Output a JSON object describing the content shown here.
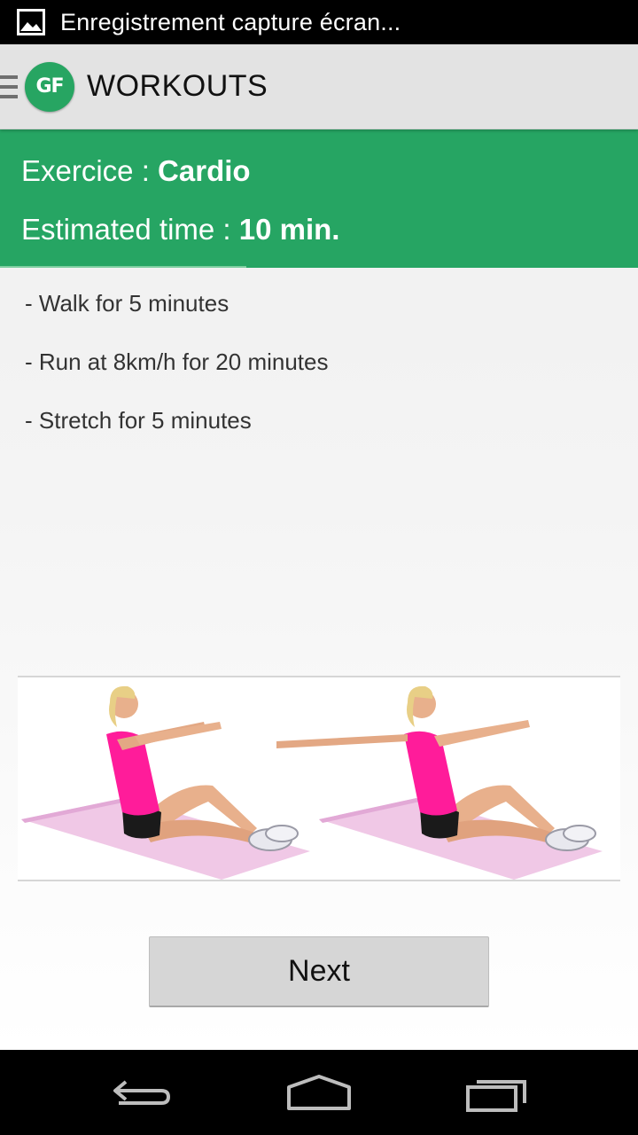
{
  "status_bar": {
    "notification_icon": "image-icon",
    "text": "Enregistrement capture écran..."
  },
  "action_bar": {
    "drawer_icon": "menu-icon",
    "logo_text": "GF",
    "title": "WORKOUTS"
  },
  "workout": {
    "exercise_label": "Exercice : ",
    "exercise_value": "Cardio",
    "time_label": "Estimated time : ",
    "time_value": "10 min.",
    "steps": [
      "- Walk for 5 minutes",
      "- Run at 8km/h for 20 minutes",
      "- Stretch for 5 minutes"
    ]
  },
  "next_button": {
    "label": "Next"
  },
  "nav_bar": {
    "back_icon": "back-icon",
    "home_icon": "home-icon",
    "recent_icon": "recent-apps-icon"
  },
  "colors": {
    "accent_green": "#26a563",
    "action_bar_bg": "#e3e3e3",
    "button_bg": "#d6d6d6"
  }
}
